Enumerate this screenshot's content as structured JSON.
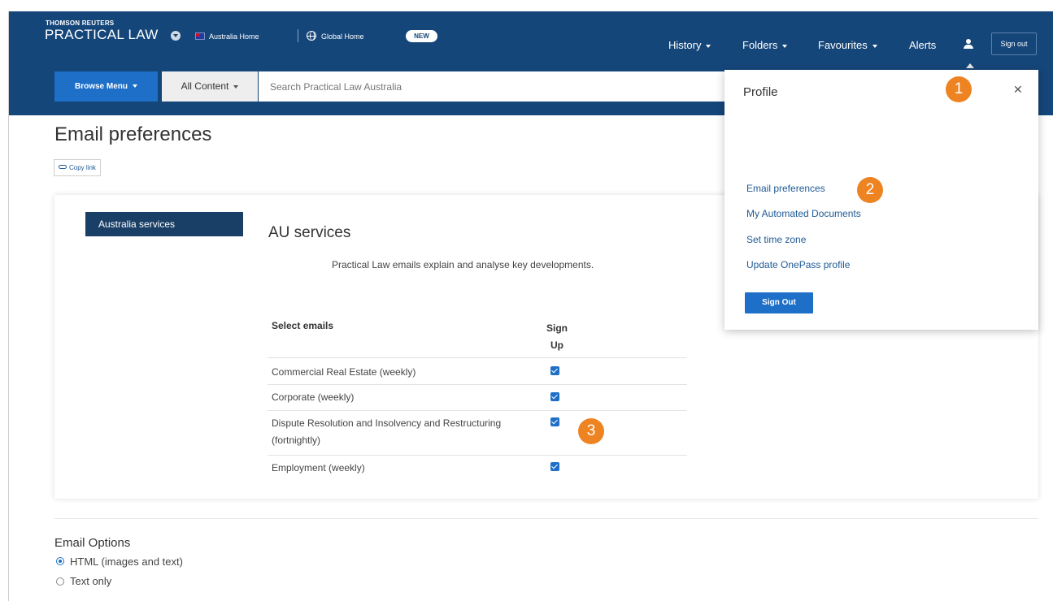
{
  "header": {
    "brand_small": "THOMSON REUTERS",
    "brand_big": "PRACTICAL LAW",
    "australia_home": "Australia Home",
    "global_home": "Global Home",
    "new_badge": "NEW",
    "menu": {
      "history": "History",
      "folders": "Folders",
      "favourites": "Favourites",
      "alerts": "Alerts"
    },
    "sign_out": "Sign out"
  },
  "search": {
    "browse_menu": "Browse Menu",
    "scope": "All Content",
    "placeholder": "Search Practical Law Australia"
  },
  "page": {
    "title": "Email preferences",
    "copy_link": "Copy link"
  },
  "services": {
    "tab_label": "Australia services",
    "heading": "AU services",
    "description": "Practical Law emails explain and analyse key developments.",
    "col_select": "Select emails",
    "col_sign": "Sign Up",
    "rows": [
      {
        "label": "Commercial Real Estate (weekly)",
        "checked": true
      },
      {
        "label": "Corporate (weekly)",
        "checked": true
      },
      {
        "label": "Dispute Resolution and Insolvency and Restructuring (fortnightly)",
        "checked": true
      },
      {
        "label": "Employment (weekly)",
        "checked": true
      }
    ]
  },
  "email_options": {
    "title": "Email Options",
    "options": [
      {
        "label": "HTML (images and text)",
        "selected": true
      },
      {
        "label": "Text only",
        "selected": false
      }
    ]
  },
  "profile": {
    "title": "Profile",
    "links": [
      "Email preferences",
      "My Automated Documents",
      "Set time zone",
      "Update OnePass profile"
    ],
    "sign_out": "Sign Out"
  },
  "callouts": [
    "1",
    "2",
    "3"
  ],
  "colors": {
    "header_bg": "#15467a",
    "primary_button": "#1e6fc8",
    "tab_bg": "#1a3f66",
    "callout": "#ee8322",
    "link": "#1e5a94"
  },
  "icons": [
    "chevron-down-icon",
    "australia-flag-icon",
    "globe-icon",
    "user-icon",
    "link-icon",
    "close-icon",
    "checkbox-checked-icon",
    "radio-icon"
  ]
}
